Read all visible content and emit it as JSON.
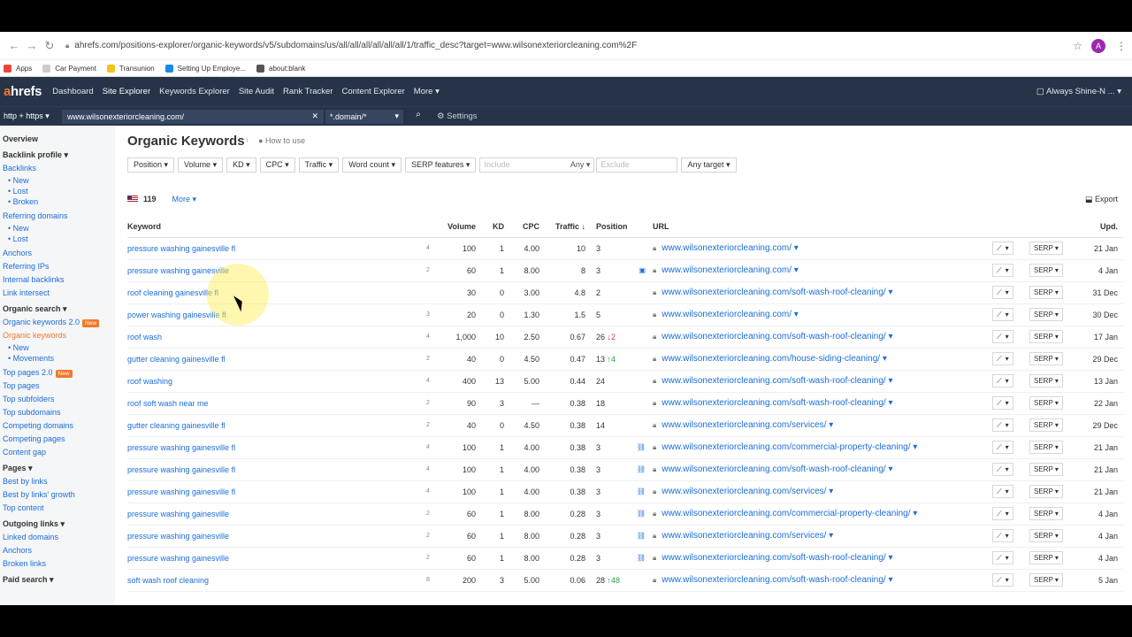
{
  "browser": {
    "url": "ahrefs.com/positions-explorer/organic-keywords/v5/subdomains/us/all/all/all/all/all/all/1/traffic_desc?target=www.wilsonexteriorcleaning.com%2F",
    "avatar_letter": "A",
    "bookmarks": [
      {
        "label": "Apps",
        "icon": "apps-icon",
        "color": "#e8453c"
      },
      {
        "label": "Car Payment",
        "icon": "page-icon",
        "color": "#cccccc"
      },
      {
        "label": "Transunion",
        "icon": "transunion-icon",
        "color": "#f6c21b"
      },
      {
        "label": "Setting Up Employe...",
        "icon": "bookmark-icon",
        "color": "#1e88e5"
      },
      {
        "label": "about:blank",
        "icon": "globe-icon",
        "color": "#555555"
      }
    ]
  },
  "nav": {
    "logo_a": "a",
    "logo_rest": "hrefs",
    "items": [
      "Dashboard",
      "Site Explorer",
      "Keywords Explorer",
      "Site Audit",
      "Rank Tracker",
      "Content Explorer",
      "More ▾"
    ],
    "account": "Always Shine-N ..."
  },
  "subnav": {
    "protocol": "http + https ▾",
    "target": "www.wilsonexteriorcleaning.com/",
    "mode": "*.domain/*",
    "settings": "Settings"
  },
  "sidebar": {
    "overview": "Overview",
    "backlink_profile": "Backlink profile ▾",
    "backlinks": "Backlinks",
    "backlinks_sub": [
      "New",
      "Lost",
      "Broken"
    ],
    "referring_domains": "Referring domains",
    "referring_sub": [
      "New",
      "Lost"
    ],
    "anchors": "Anchors",
    "referring_ips": "Referring IPs",
    "internal_backlinks": "Internal backlinks",
    "link_intersect": "Link intersect",
    "organic_search": "Organic search ▾",
    "organic_keywords_2": "Organic keywords 2.0",
    "new_badge": "New",
    "organic_keywords": "Organic keywords",
    "organic_sub": [
      "New",
      "Movements"
    ],
    "top_pages_2": "Top pages 2.0",
    "top_pages": "Top pages",
    "top_subfolders": "Top subfolders",
    "top_subdomains": "Top subdomains",
    "competing_domains": "Competing domains",
    "competing_pages": "Competing pages",
    "content_gap": "Content gap",
    "pages": "Pages ▾",
    "best_by_links": "Best by links",
    "best_by_links_growth": "Best by links' growth",
    "top_content": "Top content",
    "outgoing_links": "Outgoing links ▾",
    "linked_domains": "Linked domains",
    "anchors2": "Anchors",
    "broken_links": "Broken links",
    "paid_search": "Paid search ▾"
  },
  "main": {
    "title": "Organic Keywords",
    "title_info": "i",
    "how_to_use": "How to use",
    "filters": [
      "Position ▾",
      "Volume ▾",
      "KD ▾",
      "CPC ▾",
      "Traffic ▾",
      "Word count ▾",
      "SERP features ▾"
    ],
    "include_placeholder": "Include",
    "any_label": "Any ▾",
    "exclude_placeholder": "Exclude",
    "any_target": "Any target ▾",
    "count": "119",
    "more": "More ▾",
    "export": "Export",
    "columns": {
      "keyword": "Keyword",
      "volume": "Volume",
      "kd": "KD",
      "cpc": "CPC",
      "traffic": "Traffic ↓",
      "position": "Position",
      "url": "URL",
      "upd": "Upd."
    },
    "serp_label": "SERP ▾",
    "trend_label": "▾"
  },
  "rows": [
    {
      "keyword": "pressure washing gainesville fl",
      "comp": "4",
      "volume": "100",
      "kd": "1",
      "cpc": "4.00",
      "traffic": "10",
      "position": "3",
      "change": "",
      "change_dir": "",
      "url_icon": "",
      "url": "www.wilsonexteriorcleaning.com/ ▾",
      "upd": "21 Jan"
    },
    {
      "keyword": "pressure washing gainesville",
      "comp": "2",
      "volume": "60",
      "kd": "1",
      "cpc": "8.00",
      "traffic": "8",
      "position": "3",
      "change": "",
      "change_dir": "",
      "url_icon": "▣",
      "url": "www.wilsonexteriorcleaning.com/ ▾",
      "upd": "4 Jan"
    },
    {
      "keyword": "roof cleaning gainesville fl",
      "comp": "",
      "volume": "30",
      "kd": "0",
      "cpc": "3.00",
      "traffic": "4.8",
      "position": "2",
      "change": "",
      "change_dir": "",
      "url_icon": "",
      "url": "www.wilsonexteriorcleaning.com/soft-wash-roof-cleaning/ ▾",
      "upd": "31 Dec"
    },
    {
      "keyword": "power washing gainesville fl",
      "comp": "3",
      "volume": "20",
      "kd": "0",
      "cpc": "1.30",
      "traffic": "1.5",
      "position": "5",
      "change": "",
      "change_dir": "",
      "url_icon": "",
      "url": "www.wilsonexteriorcleaning.com/ ▾",
      "upd": "30 Dec"
    },
    {
      "keyword": "roof wash",
      "comp": "4",
      "volume": "1,000",
      "kd": "10",
      "cpc": "2.50",
      "traffic": "0.67",
      "position": "26",
      "change": "↓2",
      "change_dir": "down",
      "url_icon": "",
      "url": "www.wilsonexteriorcleaning.com/soft-wash-roof-cleaning/ ▾",
      "upd": "17 Jan"
    },
    {
      "keyword": "gutter cleaning gainesville fl",
      "comp": "2",
      "volume": "40",
      "kd": "0",
      "cpc": "4.50",
      "traffic": "0.47",
      "position": "13",
      "change": "↑4",
      "change_dir": "up",
      "url_icon": "",
      "url": "www.wilsonexteriorcleaning.com/house-siding-cleaning/ ▾",
      "upd": "29 Dec"
    },
    {
      "keyword": "roof washing",
      "comp": "4",
      "volume": "400",
      "kd": "13",
      "cpc": "5.00",
      "traffic": "0.44",
      "position": "24",
      "change": "",
      "change_dir": "",
      "url_icon": "",
      "url": "www.wilsonexteriorcleaning.com/soft-wash-roof-cleaning/ ▾",
      "upd": "13 Jan"
    },
    {
      "keyword": "roof soft wash near me",
      "comp": "2",
      "volume": "90",
      "kd": "3",
      "cpc": "—",
      "traffic": "0.38",
      "position": "18",
      "change": "",
      "change_dir": "",
      "url_icon": "",
      "url": "www.wilsonexteriorcleaning.com/soft-wash-roof-cleaning/ ▾",
      "upd": "22 Jan"
    },
    {
      "keyword": "gutter cleaning gainesville fl",
      "comp": "2",
      "volume": "40",
      "kd": "0",
      "cpc": "4.50",
      "traffic": "0.38",
      "position": "14",
      "change": "",
      "change_dir": "",
      "url_icon": "",
      "url": "www.wilsonexteriorcleaning.com/services/ ▾",
      "upd": "29 Dec"
    },
    {
      "keyword": "pressure washing gainesville fl",
      "comp": "4",
      "volume": "100",
      "kd": "1",
      "cpc": "4.00",
      "traffic": "0.38",
      "position": "3",
      "change": "",
      "change_dir": "",
      "url_icon": "⛓",
      "url": "www.wilsonexteriorcleaning.com/commercial-property-cleaning/ ▾",
      "upd": "21 Jan"
    },
    {
      "keyword": "pressure washing gainesville fl",
      "comp": "4",
      "volume": "100",
      "kd": "1",
      "cpc": "4.00",
      "traffic": "0.38",
      "position": "3",
      "change": "",
      "change_dir": "",
      "url_icon": "⛓",
      "url": "www.wilsonexteriorcleaning.com/soft-wash-roof-cleaning/ ▾",
      "upd": "21 Jan"
    },
    {
      "keyword": "pressure washing gainesville fl",
      "comp": "4",
      "volume": "100",
      "kd": "1",
      "cpc": "4.00",
      "traffic": "0.38",
      "position": "3",
      "change": "",
      "change_dir": "",
      "url_icon": "⛓",
      "url": "www.wilsonexteriorcleaning.com/services/ ▾",
      "upd": "21 Jan"
    },
    {
      "keyword": "pressure washing gainesville",
      "comp": "2",
      "volume": "60",
      "kd": "1",
      "cpc": "8.00",
      "traffic": "0.28",
      "position": "3",
      "change": "",
      "change_dir": "",
      "url_icon": "⛓",
      "url": "www.wilsonexteriorcleaning.com/commercial-property-cleaning/ ▾",
      "upd": "4 Jan"
    },
    {
      "keyword": "pressure washing gainesville",
      "comp": "2",
      "volume": "60",
      "kd": "1",
      "cpc": "8.00",
      "traffic": "0.28",
      "position": "3",
      "change": "",
      "change_dir": "",
      "url_icon": "⛓",
      "url": "www.wilsonexteriorcleaning.com/services/ ▾",
      "upd": "4 Jan"
    },
    {
      "keyword": "pressure washing gainesville",
      "comp": "2",
      "volume": "60",
      "kd": "1",
      "cpc": "8.00",
      "traffic": "0.28",
      "position": "3",
      "change": "",
      "change_dir": "",
      "url_icon": "⛓",
      "url": "www.wilsonexteriorcleaning.com/soft-wash-roof-cleaning/ ▾",
      "upd": "4 Jan"
    },
    {
      "keyword": "soft wash roof cleaning",
      "comp": "8",
      "volume": "200",
      "kd": "3",
      "cpc": "5.00",
      "traffic": "0.06",
      "position": "28",
      "change": "↑48",
      "change_dir": "up",
      "url_icon": "",
      "url": "www.wilsonexteriorcleaning.com/soft-wash-roof-cleaning/ ▾",
      "upd": "5 Jan"
    }
  ]
}
